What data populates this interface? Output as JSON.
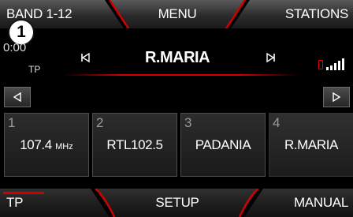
{
  "top_bar": {
    "band": "BAND 1-12",
    "menu": "MENU",
    "stations": "STATIONS"
  },
  "badge": "1",
  "status": {
    "clock": "0:00",
    "tp": "TP"
  },
  "current_station": "R.MARIA",
  "presets": [
    {
      "number": "1",
      "freq": "107.4",
      "unit": "MHz"
    },
    {
      "number": "2",
      "label": "RTL102.5"
    },
    {
      "number": "3",
      "label": "PADANIA"
    },
    {
      "number": "4",
      "label": "R.MARIA",
      "active": true
    }
  ],
  "bottom_bar": {
    "tp": "TP",
    "setup": "SETUP",
    "manual": "MANUAL"
  },
  "colors": {
    "accent": "#d20000",
    "background": "#000000"
  },
  "icons": [
    "skip-back-icon",
    "skip-forward-icon",
    "arrow-left-icon",
    "arrow-right-icon",
    "battery-icon",
    "signal-icon"
  ]
}
